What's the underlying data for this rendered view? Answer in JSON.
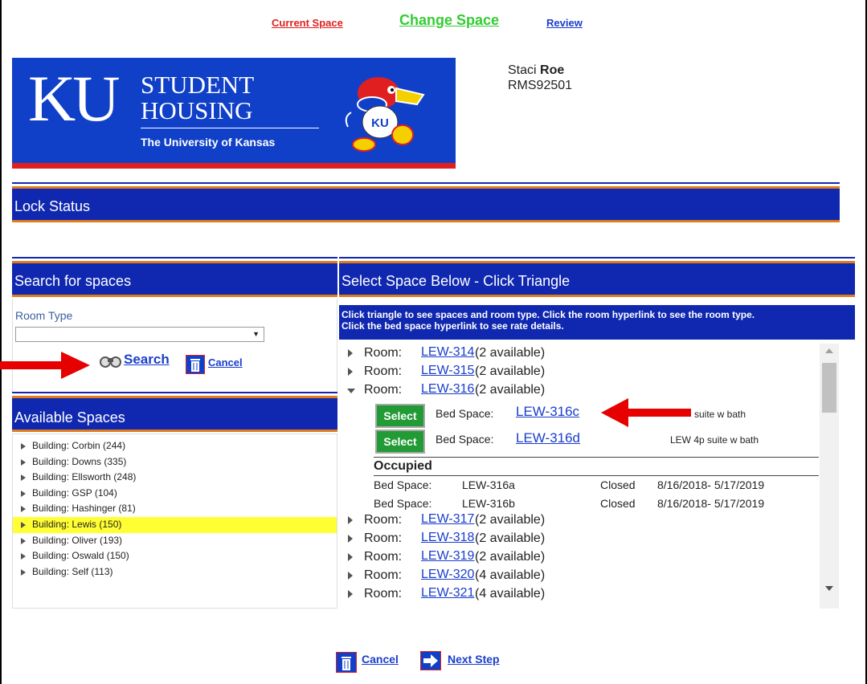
{
  "nav": {
    "current_space": "Current Space",
    "change_space": "Change Space",
    "review": "Review"
  },
  "banner": {
    "logo_ku": "KU",
    "line1": "STUDENT",
    "line2": "HOUSING",
    "subtitle": "The University of Kansas",
    "mascot_badge": "KU"
  },
  "user": {
    "first_name": "Staci",
    "last_name": "Roe",
    "id": "RMS92501"
  },
  "sections": {
    "lock_status": "Lock Status",
    "search": "Search for spaces",
    "select_space": "Select Space Below - Click Triangle",
    "available_spaces": "Available Spaces"
  },
  "search": {
    "room_type_label": "Room Type",
    "room_type_value": "",
    "search_label": "Search",
    "cancel_label": "Cancel"
  },
  "instructions": {
    "line1": "Click triangle to see spaces and room type. Click the room hyperlink to see the room type.",
    "line2": "Click the bed space hyperlink to see rate details."
  },
  "buildings": [
    {
      "label": "Building: Corbin (244)"
    },
    {
      "label": "Building: Downs (335)"
    },
    {
      "label": "Building: Ellsworth (248)"
    },
    {
      "label": "Building: GSP (104)"
    },
    {
      "label": "Building: Hashinger (81)"
    },
    {
      "label": "Building: Lewis (150)",
      "highlighted": true
    },
    {
      "label": "Building: Oliver (193)"
    },
    {
      "label": "Building: Oswald (150)"
    },
    {
      "label": "Building: Self (113)"
    }
  ],
  "rooms": {
    "room_prefix": "Room:",
    "before": [
      {
        "room": "LEW-314",
        "available": "(2 available)"
      },
      {
        "room": "LEW-315",
        "available": "(2 available)"
      }
    ],
    "expanded": {
      "room": "LEW-316",
      "available": "(2 available)"
    },
    "after": [
      {
        "room": "LEW-317",
        "available": "(2 available)"
      },
      {
        "room": "LEW-318",
        "available": "(2 available)"
      },
      {
        "room": "LEW-319",
        "available": "(2 available)"
      },
      {
        "room": "LEW-320",
        "available": "(4 available)"
      },
      {
        "room": "LEW-321",
        "available": "(4 available)"
      }
    ]
  },
  "bed_spaces": {
    "select_label": "Select",
    "bed_space_label": "Bed Space:",
    "available": [
      {
        "bed": "LEW-316c",
        "type": "suite w bath"
      },
      {
        "bed": "LEW-316d",
        "type": "LEW 4p suite w bath"
      }
    ],
    "occupied_heading": "Occupied",
    "occupied": [
      {
        "label": "Bed Space:",
        "bed": "LEW-316a",
        "status": "Closed",
        "dates": "8/16/2018- 5/17/2019"
      },
      {
        "label": "Bed Space:",
        "bed": "LEW-316b",
        "status": "Closed",
        "dates": "8/16/2018- 5/17/2019"
      }
    ]
  },
  "footer": {
    "cancel_label": "Cancel",
    "next_label": "Next Step"
  },
  "colors": {
    "section_bar": "#1028b0",
    "section_border": "#e07c1c",
    "banner_blue": "#1040c8",
    "banner_red": "#e02020",
    "select_button": "#229b36",
    "highlight": "#ffff33",
    "annotation_arrow": "#e60000",
    "link": "#1a3ecc"
  },
  "icons": {
    "search": "binoculars-icon",
    "cancel": "trash-icon",
    "next": "arrow-right-icon",
    "tree_toggle": "triangle-icon"
  }
}
